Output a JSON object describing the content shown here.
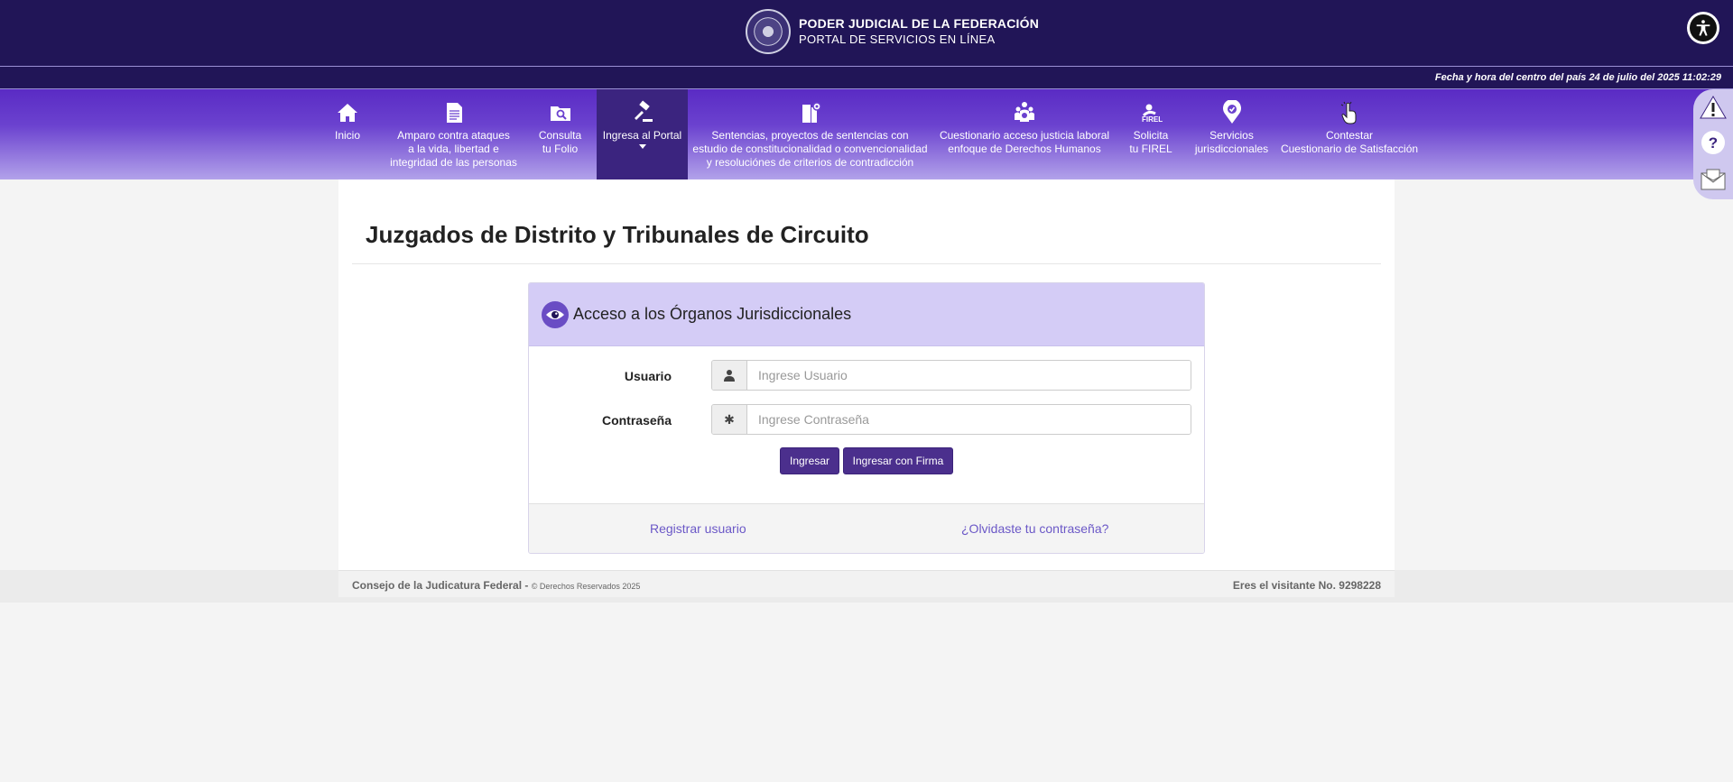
{
  "header": {
    "org_line1": "PODER JUDICIAL DE LA FEDERACIÓN",
    "org_line2": "PORTAL DE SERVICIOS EN LÍNEA",
    "datetime": "Fecha y hora del centro del país 24 de julio del 2025 11:02:29"
  },
  "nav": [
    {
      "icon": "home-icon",
      "l1": "Inicio",
      "l2": "",
      "l3": ""
    },
    {
      "icon": "document-icon",
      "l1": "Amparo contra ataques",
      "l2": "a la vida, libertad e",
      "l3": "integridad de las personas"
    },
    {
      "icon": "search-folder-icon",
      "l1": "Consulta",
      "l2": "tu Folio",
      "l3": ""
    },
    {
      "icon": "gavel-icon",
      "l1": "Ingresa al Portal",
      "l2": "",
      "l3": ""
    },
    {
      "icon": "book-settings-icon",
      "l1": "Sentencias, proyectos de sentencias con",
      "l2": "estudio de constitucionalidad o convencionalidad",
      "l3": "y resoluciónes de criterios de contradicción"
    },
    {
      "icon": "people-icon",
      "l1": "Cuestionario acceso justicia laboral",
      "l2": "enfoque de Derechos Humanos",
      "l3": ""
    },
    {
      "icon": "firel-icon",
      "l1": "Solicita",
      "l2": "tu FIREL",
      "l3": ""
    },
    {
      "icon": "location-icon",
      "l1": "Servicios",
      "l2": "jurisdiccionales",
      "l3": ""
    },
    {
      "icon": "pointer-hand-icon",
      "l1": "Contestar",
      "l2": "Cuestionario de Satisfacción",
      "l3": ""
    }
  ],
  "page": {
    "title": "Juzgados de Distrito y Tribunales de Circuito"
  },
  "login": {
    "panel_title": "Acceso a los Órganos Jurisdiccionales",
    "user_label": "Usuario",
    "user_placeholder": "Ingrese Usuario",
    "password_label": "Contraseña",
    "password_placeholder": "Ingrese Contraseña",
    "submit_label": "Ingresar",
    "sign_label": "Ingresar con Firma",
    "register_link": "Registrar usuario",
    "forgot_link": "¿Olvidaste tu contraseña?"
  },
  "footer": {
    "org": "Consejo de la Judicatura Federal -",
    "rights": "© Derechos Reservados 2025",
    "visitor": "Eres el visitante No. 9298228"
  },
  "colors": {
    "header_bg": "#211557",
    "nav_gradient_top": "#5a2bc4",
    "nav_active": "#3b247f",
    "panel_head": "#d4ccf6",
    "button": "#4b2f8d",
    "link": "#6b58c7"
  }
}
